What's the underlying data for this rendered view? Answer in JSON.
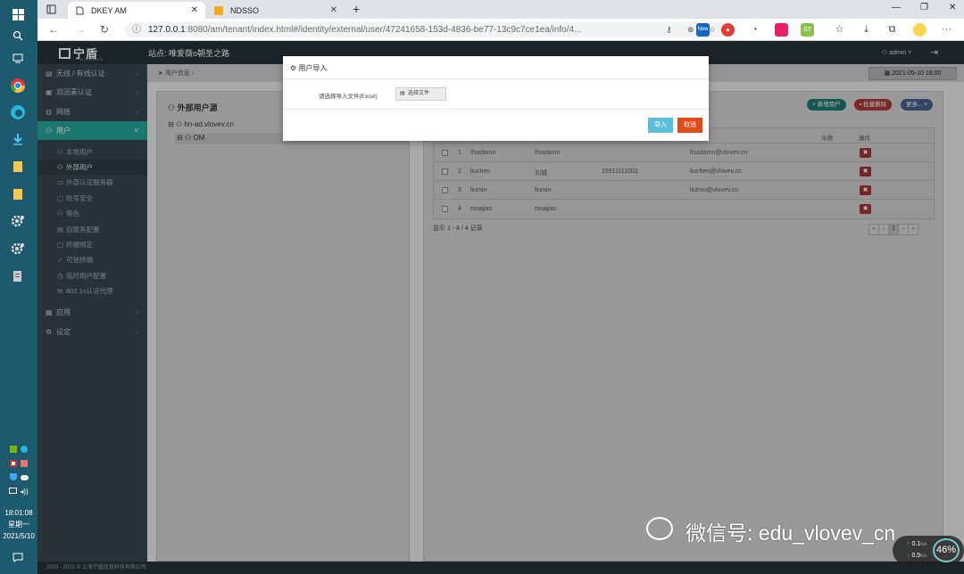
{
  "browser": {
    "tabs": [
      {
        "label": "DKEY AM"
      },
      {
        "label": "NDSSO"
      }
    ],
    "url_host": "127.0.0.1",
    "url_path": ":8080/am/tenant/index.html#/identity/external/user/47241658-153d-4836-be77-13c9c7ce1ea/info/4...",
    "ext_new": "New",
    "ext_st": "ST"
  },
  "taskbar": {
    "time": "18:01:08",
    "weekday": "星期一",
    "date": "2021/5/10"
  },
  "header": {
    "logo": "宁盾",
    "logo_sub": "NINGDUN",
    "site": "站点: 唯爱薇o朝圣之路",
    "admin": "admin"
  },
  "sidebar": {
    "items": [
      {
        "label": "无线 / 有线认证"
      },
      {
        "label": "双因素认证"
      },
      {
        "label": "网络"
      },
      {
        "label": "用户"
      }
    ],
    "subs": [
      {
        "label": "本地用户"
      },
      {
        "label": "外部用户"
      },
      {
        "label": "外部认证服务器"
      },
      {
        "label": "账号安全"
      },
      {
        "label": "角色"
      },
      {
        "label": "自服务配置"
      },
      {
        "label": "终端绑定"
      },
      {
        "label": "可信终端"
      },
      {
        "label": "临时用户配置"
      },
      {
        "label": "802.1x认证代理"
      }
    ],
    "bottom": [
      {
        "label": "应用"
      },
      {
        "label": "设定"
      }
    ]
  },
  "breadcrumb": "用户信息",
  "date_display": "2021-05-10 18:00",
  "left_panel": {
    "title": "外部用户源",
    "tree": [
      {
        "label": "hn-ad.vlovev.cn"
      },
      {
        "label": "OM"
      }
    ]
  },
  "right_panel": {
    "buttons": {
      "new_user": "+ 新增用户",
      "batch_delete": "批量删除",
      "more": "更多..."
    },
    "headers": {
      "token": "令牌",
      "ops": "操作"
    },
    "rows": [
      {
        "no": "1",
        "username": "lfsadamn",
        "name": "lfsadamn",
        "phone": "",
        "email": "lfsadamn@vlovev.cn"
      },
      {
        "no": "2",
        "username": "liuchen",
        "name": "刘城",
        "phone": "15911111001",
        "email": "liuchen@vlovev.cn"
      },
      {
        "no": "3",
        "username": "liumin",
        "name": "liumin",
        "phone": "",
        "email": "liumin@vlovev.cn"
      },
      {
        "no": "4",
        "username": "moajiao",
        "name": "moajiao",
        "phone": "",
        "email": ""
      }
    ],
    "summary": "显示 1 - 4 / 4 记录",
    "pager": [
      "«",
      "‹",
      "1",
      "›",
      "»"
    ]
  },
  "modal": {
    "title": "用户导入",
    "file_label": "请选择导入文件(Excel)",
    "file_button": "选择文件",
    "import": "导入",
    "cancel": "取消"
  },
  "footer": "2009 - 2021 © 上海宁盾信息科技有限公司",
  "watermark": "微信号: edu_vlovev_cn",
  "netmon": {
    "up": "0.1",
    "down": "0.5",
    "unit": "K/s",
    "percent": "46%"
  },
  "colors": {
    "accent": "#26a69a",
    "danger": "#e64a19",
    "info": "#5bc0de"
  }
}
